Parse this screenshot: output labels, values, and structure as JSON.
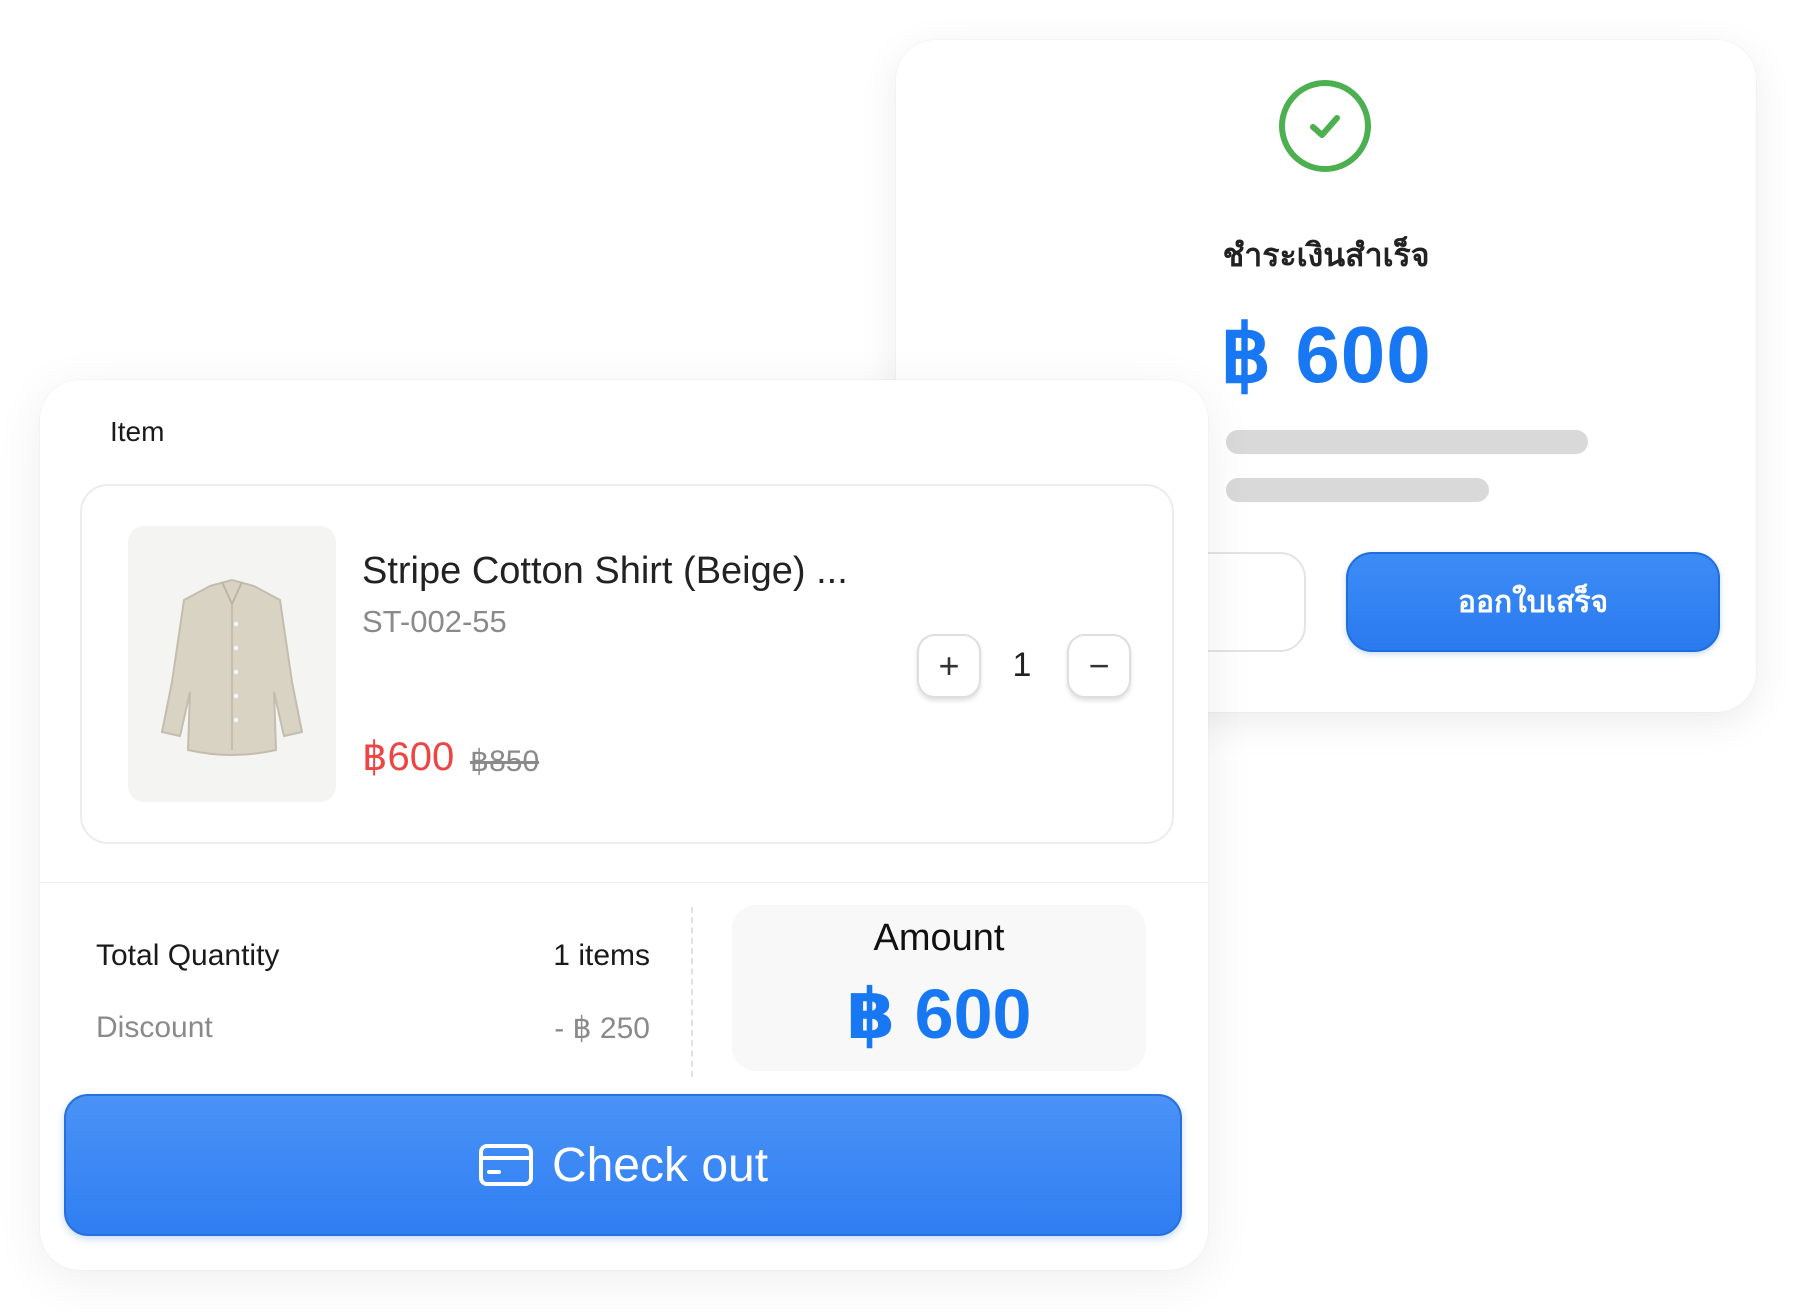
{
  "success": {
    "title": "ชำระเงินสำเร็จ",
    "amount": "฿ 600",
    "receipt_button": "ออกใบเสร็จ",
    "icon": "check-circle-icon",
    "success_color": "#4caf50"
  },
  "cart": {
    "section_label": "Item",
    "item": {
      "name": "Stripe Cotton Shirt (Beige) ...",
      "sku": "ST-002-55",
      "price": "฿600",
      "original_price": "฿850",
      "quantity": "1",
      "plus_symbol": "+",
      "minus_symbol": "−",
      "image": "beige-shirt-image"
    },
    "summary": {
      "total_quantity_label": "Total Quantity",
      "total_quantity_value": "1 items",
      "discount_label": "Discount",
      "discount_value": "- ฿ 250",
      "amount_label": "Amount",
      "amount_value": "฿ 600"
    },
    "checkout_button": "Check out",
    "checkout_icon": "credit-card-icon"
  },
  "colors": {
    "accent": "#1877f2",
    "button_blue": "#3a88f4",
    "sale_red": "#ef4444",
    "muted": "#8a8a8a"
  }
}
